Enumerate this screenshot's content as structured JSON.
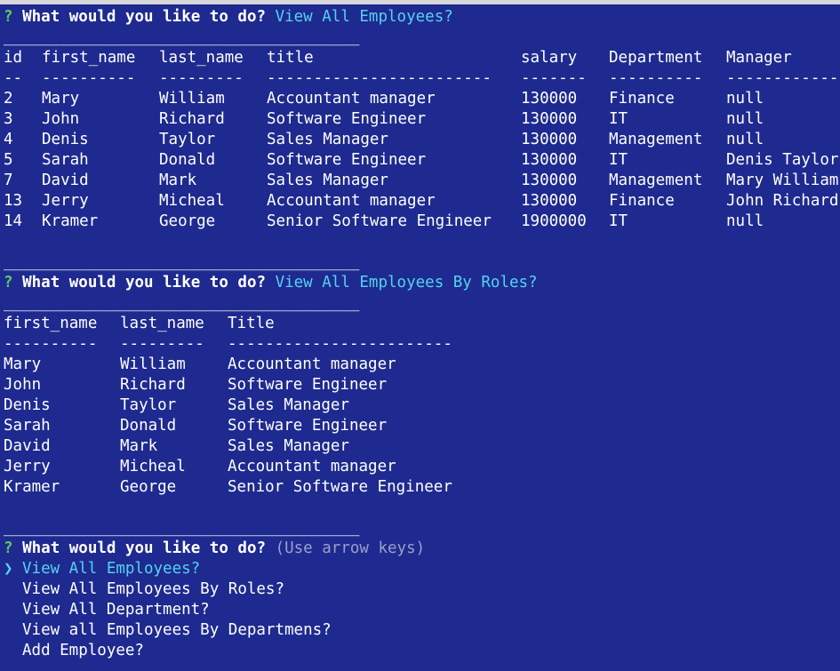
{
  "prompt": {
    "mark": "?",
    "question": "What would you like to do?"
  },
  "section1": {
    "answer": "View All Employees?",
    "separator": "______________________________________",
    "headers": [
      "id",
      "first_name",
      "last_name",
      "title",
      "salary",
      "Department",
      "Manager"
    ],
    "dashes": [
      "--",
      "----------",
      "---------",
      "------------------------",
      "-------",
      "----------",
      "------------"
    ],
    "rows": [
      [
        "2",
        "Mary",
        "William",
        "Accountant manager",
        "130000",
        "Finance",
        "null"
      ],
      [
        "3",
        "John",
        "Richard",
        "Software Engineer",
        "130000",
        "IT",
        "null"
      ],
      [
        "4",
        "Denis",
        "Taylor",
        "Sales Manager",
        "130000",
        "Management",
        "null"
      ],
      [
        "5",
        "Sarah",
        "Donald",
        "Software Engineer",
        "130000",
        "IT",
        "Denis Taylor"
      ],
      [
        "7",
        "David",
        "Mark",
        "Sales Manager",
        "130000",
        "Management",
        "Mary William"
      ],
      [
        "13",
        "Jerry",
        "Micheal",
        "Accountant manager",
        "130000",
        "Finance",
        "John Richard"
      ],
      [
        "14",
        "Kramer",
        "George",
        "Senior Software Engineer",
        "1900000",
        "IT",
        "null"
      ]
    ]
  },
  "section2": {
    "separator_top": "______________________________________",
    "answer": "View All Employees By Roles?",
    "separator": "______________________________________",
    "headers": [
      "first_name",
      "last_name",
      "Title"
    ],
    "dashes": [
      "----------",
      "---------",
      "------------------------"
    ],
    "rows": [
      [
        "Mary",
        "William",
        "Accountant manager"
      ],
      [
        "John",
        "Richard",
        "Software Engineer"
      ],
      [
        "Denis",
        "Taylor",
        "Sales Manager"
      ],
      [
        "Sarah",
        "Donald",
        "Software Engineer"
      ],
      [
        "David",
        "Mark",
        "Sales Manager"
      ],
      [
        "Jerry",
        "Micheal",
        "Accountant manager"
      ],
      [
        "Kramer",
        "George",
        "Senior Software Engineer"
      ]
    ]
  },
  "section3": {
    "separator_top": "______________________________________",
    "hint": "(Use arrow keys)",
    "cursor": "❯",
    "options": [
      "View All Employees?",
      "View All Employees By Roles?",
      "View All Department?",
      "View all Employees By Departmens?",
      "Add Employee?"
    ],
    "selected_index": 0
  },
  "colors": {
    "background": "#1e2a8f",
    "prompt_mark": "#5ec95e",
    "answer": "#54d2ef",
    "hint": "#9aa0c8"
  }
}
